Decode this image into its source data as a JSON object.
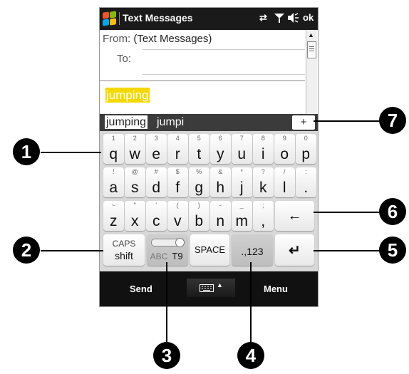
{
  "statusbar": {
    "title": "Text Messages",
    "ok_label": "ok"
  },
  "compose": {
    "from_label": "From:",
    "from_value": "(Text Messages)",
    "to_label": "To:",
    "message_text": "jumping"
  },
  "suggestions": {
    "items": [
      "jumping",
      "jumpi"
    ],
    "add_label": "+"
  },
  "keyboard": {
    "row1": [
      {
        "s": "1",
        "p": "q"
      },
      {
        "s": "2",
        "p": "w"
      },
      {
        "s": "3",
        "p": "e"
      },
      {
        "s": "4",
        "p": "r"
      },
      {
        "s": "5",
        "p": "t"
      },
      {
        "s": "6",
        "p": "y"
      },
      {
        "s": "7",
        "p": "u"
      },
      {
        "s": "8",
        "p": "i"
      },
      {
        "s": "9",
        "p": "o"
      },
      {
        "s": "0",
        "p": "p"
      }
    ],
    "row2": [
      {
        "s": "!",
        "p": "a"
      },
      {
        "s": "@",
        "p": "s"
      },
      {
        "s": "#",
        "p": "d"
      },
      {
        "s": "$",
        "p": "f"
      },
      {
        "s": "%",
        "p": "g"
      },
      {
        "s": "&",
        "p": "h"
      },
      {
        "s": "*",
        "p": "j"
      },
      {
        "s": "?",
        "p": "k"
      },
      {
        "s": "/",
        "p": "l"
      },
      {
        "s": ":",
        "p": "."
      }
    ],
    "row3": [
      {
        "s": "~",
        "p": "z"
      },
      {
        "s": "\"",
        "p": "x"
      },
      {
        "s": "'",
        "p": "c"
      },
      {
        "s": "(",
        "p": "v"
      },
      {
        "s": ")",
        "p": "b"
      },
      {
        "s": "-",
        "p": "n"
      },
      {
        "s": "_",
        "p": "m"
      },
      {
        "s": ";",
        "p": ","
      }
    ],
    "backspace_label": "←",
    "caps_label": "CAPS",
    "shift_label": "shift",
    "abc_label": "ABC",
    "t9_label": "T9",
    "space_label": "SPACE",
    "num_label": ".,123",
    "enter_label": "↵"
  },
  "softkeys": {
    "left": "Send",
    "right": "Menu",
    "center_caret": "▲"
  },
  "callouts": {
    "c1": "1",
    "c2": "2",
    "c3": "3",
    "c4": "4",
    "c5": "5",
    "c6": "6",
    "c7": "7"
  },
  "colors": {
    "highlight": "#f5d800",
    "titlebar": "#1a1a1a"
  }
}
